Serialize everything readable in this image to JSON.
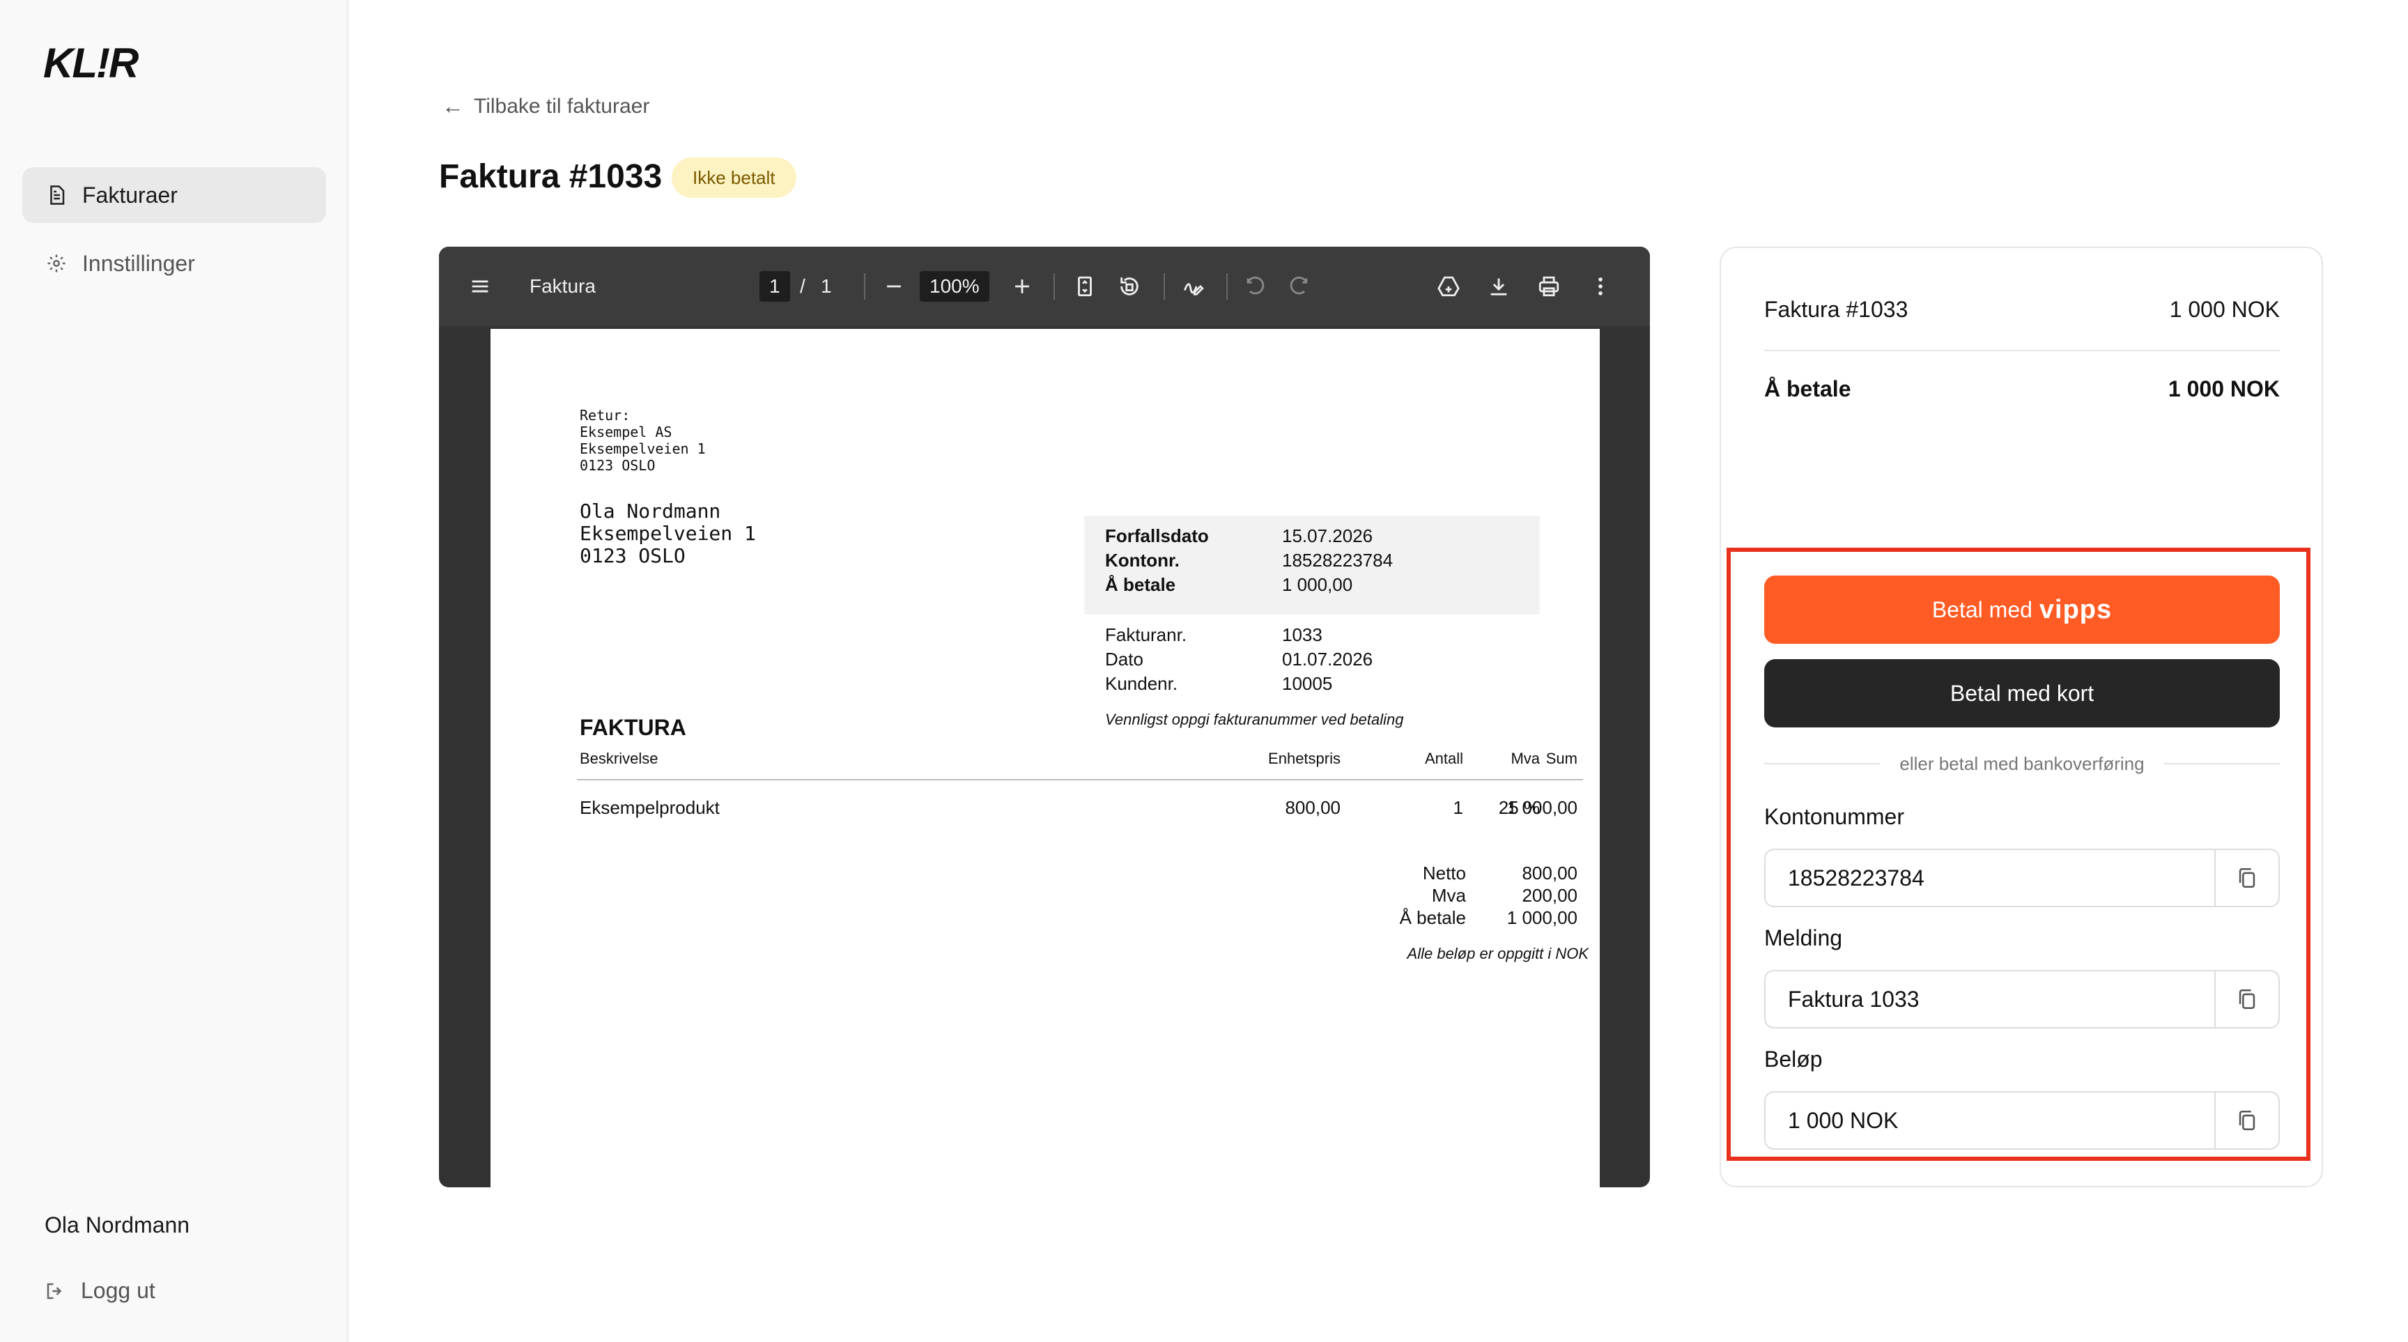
{
  "brand": {
    "logo_text": "KL!R",
    "accent": "#ff5b24"
  },
  "sidebar": {
    "items": [
      {
        "label": "Fakturaer",
        "icon": "document-icon",
        "active": true
      },
      {
        "label": "Innstillinger",
        "icon": "gear-icon",
        "active": false
      }
    ],
    "user_name": "Ola Nordmann",
    "logout_label": "Logg ut"
  },
  "header": {
    "back_label": "Tilbake til fakturaer",
    "title": "Faktura #1033",
    "status": "Ikke betalt"
  },
  "pdf_viewer": {
    "title": "Faktura",
    "current_page": "1",
    "page_separator": "/",
    "total_pages": "1",
    "zoom": "100%"
  },
  "invoice": {
    "return_lines": [
      "Retur:",
      "Eksempel AS",
      "Eksempelveien 1",
      "0123 OSLO"
    ],
    "recipient_lines": [
      "Ola Nordmann",
      "Eksempelveien 1",
      "0123 OSLO"
    ],
    "due_label": "Forfallsdato",
    "due_value": "15.07.2026",
    "account_label": "Kontonr.",
    "account_value": "18528223784",
    "pay_label": "Å betale",
    "pay_value": "1 000,00",
    "invoice_no_label": "Fakturanr.",
    "invoice_no_value": "1033",
    "date_label": "Dato",
    "date_value": "01.07.2026",
    "customer_label": "Kundenr.",
    "customer_value": "10005",
    "payment_note": "Vennligst oppgi fakturanummer ved betaling",
    "heading": "FAKTURA",
    "columns": {
      "desc": "Beskrivelse",
      "unit_price": "Enhetspris",
      "qty": "Antall",
      "vat": "Mva",
      "sum": "Sum"
    },
    "line": {
      "desc": "Eksempelprodukt",
      "unit_price": "800,00",
      "qty": "1",
      "vat": "25 %",
      "sum": "1 000,00"
    },
    "totals": {
      "net_label": "Netto",
      "net_value": "800,00",
      "vat_label": "Mva",
      "vat_value": "200,00",
      "pay_label": "Å betale",
      "pay_value": "1 000,00"
    },
    "currency_note": "Alle beløp er oppgitt i NOK"
  },
  "payment": {
    "invoice_label": "Faktura #1033",
    "invoice_amount": "1 000 NOK",
    "to_pay_label": "Å betale",
    "to_pay_amount": "1 000 NOK",
    "vipps_prefix": "Betal med",
    "vipps_logo": "vipps",
    "card_label": "Betal med kort",
    "bank_transfer_label": "eller betal med bankoverføring",
    "account_label": "Kontonummer",
    "account_value": "18528223784",
    "message_label": "Melding",
    "message_value": "Faktura 1033",
    "amount_label": "Beløp",
    "amount_value": "1 000 NOK"
  },
  "colors": {
    "highlight": "#e8321e",
    "vipps": "#ff5b24",
    "card_button": "#262626",
    "badge_bg": "#fdf2c2"
  }
}
